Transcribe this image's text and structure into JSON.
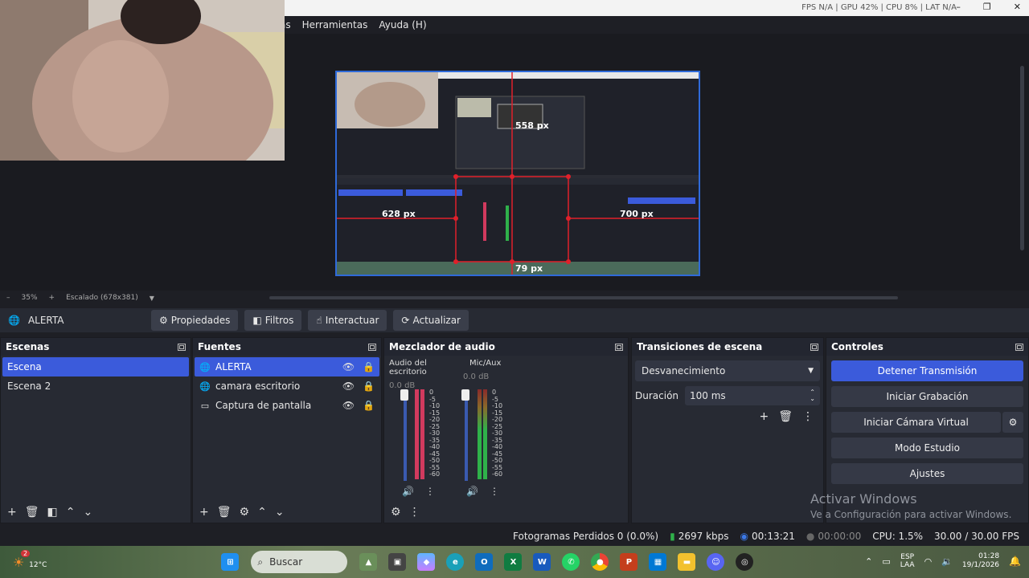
{
  "titlebar": {
    "stats": "FPS N/A | GPU 42% | CPU 8% | LAT N/A",
    "minimize": "–",
    "restore": "❐",
    "close": "✕"
  },
  "menu": [
    "as",
    "Herramientas",
    "Ayuda (H)"
  ],
  "preview": {
    "measurements": [
      "558 px",
      "628 px",
      "700 px",
      "79 px"
    ]
  },
  "zoombar": {
    "minus": "–",
    "zoom": "35%",
    "plus": "+",
    "scale": "Escalado (678x381)"
  },
  "context": {
    "source": "ALERTA",
    "buttons": [
      "Propiedades",
      "Filtros",
      "Interactuar",
      "Actualizar"
    ]
  },
  "scenes": {
    "title": "Escenas",
    "items": [
      "Escena",
      "Escena 2"
    ],
    "selected": 0
  },
  "sources": {
    "title": "Fuentes",
    "items": [
      {
        "label": "ALERTA",
        "icon": "globe-icon"
      },
      {
        "label": "camara escritorio",
        "icon": "globe-icon"
      },
      {
        "label": "Captura de pantalla",
        "icon": "monitor-icon"
      }
    ]
  },
  "mixer": {
    "title": "Mezclador de audio",
    "channels": [
      {
        "name": "Audio del escritorio",
        "db": "0.0 dB",
        "color": "#d13a5e"
      },
      {
        "name": "Mic/Aux",
        "db": "0.0 dB",
        "color": "#2fb14a"
      }
    ],
    "scale": [
      "0",
      "-5",
      "-10",
      "-15",
      "-20",
      "-25",
      "-30",
      "-35",
      "-40",
      "-45",
      "-50",
      "-55",
      "-60"
    ]
  },
  "transitions": {
    "title": "Transiciones de escena",
    "selected": "Desvanecimiento",
    "duration_label": "Duración",
    "duration_value": "100 ms"
  },
  "controls": {
    "title": "Controles",
    "buttons": [
      "Detener Transmisión",
      "Iniciar Grabación",
      "Iniciar Cámara Virtual",
      "Modo Estudio",
      "Ajustes"
    ]
  },
  "activate": {
    "title": "Activar Windows",
    "subtitle": "Ve a Configuración para activar Windows."
  },
  "status": {
    "dropped": "Fotogramas Perdidos 0 (0.0%)",
    "bitrate": "2697 kbps",
    "stream_time": "00:13:21",
    "rec_time": "00:00:00",
    "cpu": "CPU: 1.5%",
    "fps": "30.00 / 30.00 FPS"
  },
  "taskbar": {
    "search_placeholder": "Buscar",
    "lang": "ESP",
    "region": "LAA",
    "time": "01:28",
    "date": "19/1/2026",
    "badge": "2",
    "weather_label": "12°C"
  },
  "colors": {
    "accent": "#3b5bdb",
    "selection_border": "#2f6ad9",
    "guide": "#e0202a"
  }
}
